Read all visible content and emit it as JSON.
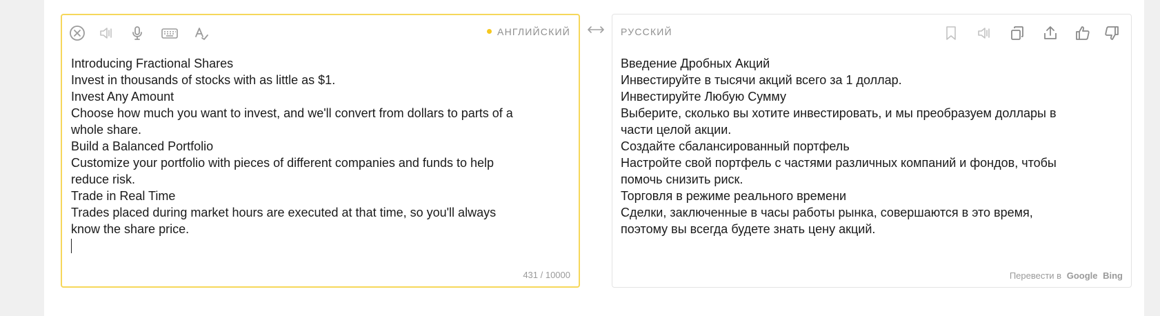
{
  "source": {
    "language": "АНГЛИЙСКИЙ",
    "lines": [
      "Introducing Fractional Shares",
      "Invest in thousands of stocks with as little as $1.",
      "Invest Any Amount",
      "Choose how much you want to invest, and we'll convert from dollars to parts of a",
      "whole share.",
      "Build a Balanced Portfolio",
      "Customize your portfolio with pieces of different companies and funds to help",
      "reduce risk.",
      "Trade in Real Time",
      "Trades placed during market hours are executed at that time, so you'll always",
      "know the share price."
    ],
    "char_count": "431 / 10000",
    "toolbar_icons": [
      "clear-icon",
      "speaker-icon",
      "microphone-icon",
      "keyboard-icon",
      "spellcheck-icon"
    ]
  },
  "target": {
    "language": "РУССКИЙ",
    "lines": [
      "Введение Дробных Акций",
      "Инвестируйте в тысячи акций всего за 1 доллар.",
      "Инвестируйте Любую Сумму",
      "Выберите, сколько вы хотите инвестировать, и мы преобразуем доллары в",
      "части целой акции.",
      "Создайте сбалансированный портфель",
      "Настройте свой портфель с частями различных компаний и фондов, чтобы",
      "помочь снизить риск.",
      "Торговля в режиме реального времени",
      "Сделки, заключенные в часы работы рынка, совершаются в это время,",
      "поэтому вы всегда будете знать цену акций."
    ],
    "toolbar_icons": [
      "bookmark-icon",
      "speaker-icon",
      "copy-icon",
      "share-icon",
      "thumbs-up-icon",
      "thumbs-down-icon"
    ],
    "translate_in_label": "Перевести в",
    "engines": [
      "Google",
      "Bing"
    ]
  },
  "swap_icon": "swap-arrows-icon",
  "colors": {
    "accent": "#f6d75a",
    "dot": "#f6c81f",
    "muted_text": "#8e8e8e",
    "icon": "#9b9b9b"
  }
}
